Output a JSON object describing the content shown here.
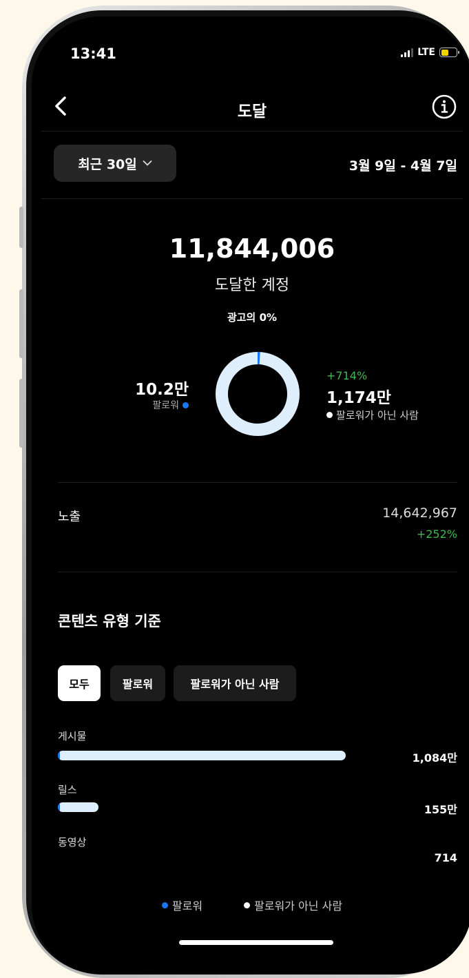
{
  "status_bar": {
    "time": "13:41",
    "network": "LTE",
    "battery_color": "#f2d300"
  },
  "nav": {
    "title": "도달",
    "back_icon": "chevron-left-icon",
    "info_icon": "info-icon"
  },
  "period": {
    "selector_label": "최근 30일",
    "date_range": "3월 9일 - 4월 7일"
  },
  "summary": {
    "accounts_reached": "11,844,006",
    "accounts_reached_label": "도달한 계정",
    "ads_label": "광고의 0%"
  },
  "audience": {
    "followers_value": "10.2만",
    "followers_label": "팔로워",
    "followers_share": 0.01,
    "non_followers_change": "+714%",
    "non_followers_value": "1,174만",
    "non_followers_label": "팔로워가 아닌 사람",
    "follower_color": "#1877f2",
    "non_follower_color": "#deeefc"
  },
  "impressions": {
    "label": "노출",
    "value": "14,642,967",
    "change": "+252%"
  },
  "content_type": {
    "title": "콘텐츠 유형 기준",
    "filters": [
      "모두",
      "팔로워",
      "팔로워가 아닌 사람"
    ],
    "active_filter": "모두",
    "rows": [
      {
        "label": "게시물",
        "value": "1,084만",
        "fraction": 1.0
      },
      {
        "label": "릴스",
        "value": "155만",
        "fraction": 0.14
      },
      {
        "label": "동영상",
        "value": "714",
        "fraction": 0
      }
    ]
  },
  "legend": {
    "followers": "팔로워",
    "non_followers": "팔로워가 아닌 사람"
  }
}
